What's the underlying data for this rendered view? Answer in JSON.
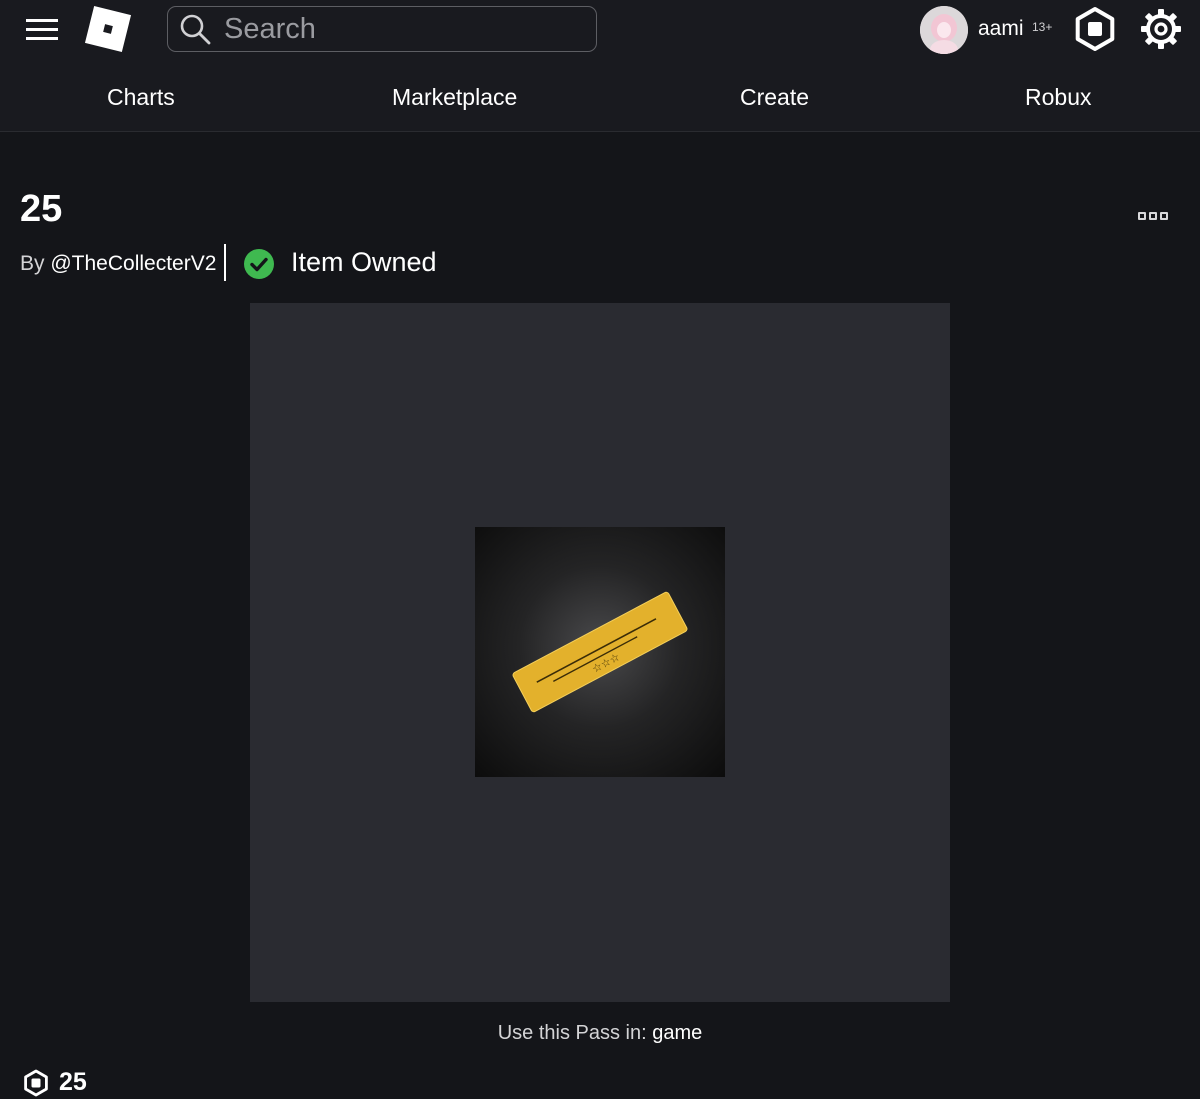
{
  "header": {
    "search": {
      "placeholder": "Search"
    },
    "user": {
      "name": "aami",
      "age_badge": "13+"
    },
    "nav": [
      {
        "label": "Charts"
      },
      {
        "label": "Marketplace"
      },
      {
        "label": "Create"
      },
      {
        "label": "Robux"
      }
    ],
    "icons": [
      "menu-icon",
      "roblox-logo-icon",
      "search-icon",
      "robux-icon",
      "gear-icon"
    ]
  },
  "item": {
    "title": "25",
    "by_prefix": "By",
    "creator": "@TheCollecterV2",
    "owned_label": "Item Owned",
    "use_prefix": "Use this Pass in:",
    "game_name": "game",
    "price": "25"
  },
  "colors": {
    "background": "#141519",
    "header": "#191a1f",
    "panel": "#2a2b31",
    "owned_green": "#3fb950",
    "ticket_gold": "#e3b12c"
  }
}
